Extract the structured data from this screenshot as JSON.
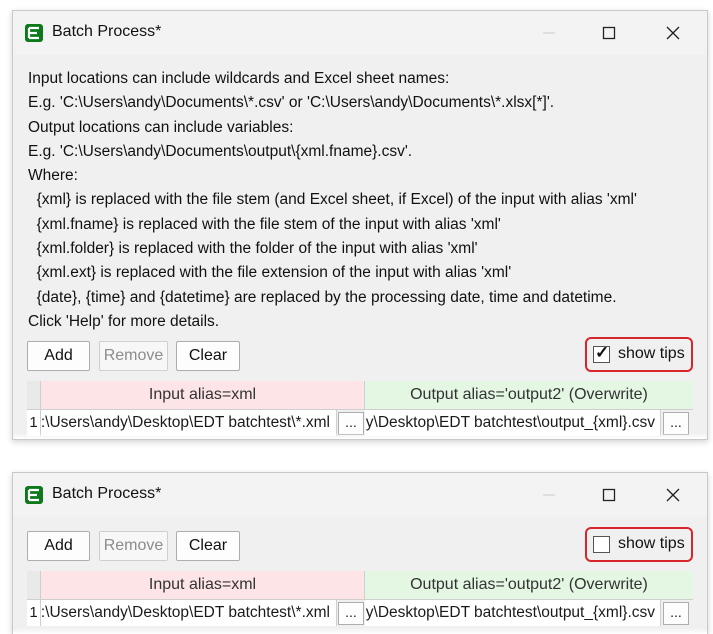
{
  "windows": [
    {
      "title": "Batch Process*",
      "help_lines": [
        "Input locations can include wildcards and Excel sheet names:",
        "E.g. 'C:\\Users\\andy\\Documents\\*.csv' or 'C:\\Users\\andy\\Documents\\*.xlsx[*]'.",
        "Output locations can include variables:",
        "E.g. 'C:\\Users\\andy\\Documents\\output\\{xml.fname}.csv'.",
        "Where:",
        "  {xml} is replaced with the file stem (and Excel sheet, if Excel) of the input with alias 'xml'",
        "  {xml.fname} is replaced with the file stem of the input with alias 'xml'",
        "  {xml.folder} is replaced with the folder of the input with alias 'xml'",
        "  {xml.ext} is replaced with the file extension of the input with alias 'xml'",
        "  {date}, {time} and {datetime} are replaced by the processing date, time and datetime.",
        "Click 'Help' for more details."
      ],
      "buttons": {
        "add": "Add",
        "remove": "Remove",
        "clear": "Clear"
      },
      "show_tips": {
        "label": "show tips",
        "checked": true,
        "check_glyph": "✓"
      },
      "grid": {
        "input_header": "Input alias=xml",
        "output_header": "Output alias='output2' (Overwrite)",
        "rows": [
          {
            "num": "1",
            "input": "C:\\Users\\andy\\Desktop\\EDT batchtest\\*.xml",
            "output": "C:\\Users\\andy\\Desktop\\EDT batchtest\\output_{xml}.csv",
            "browse": "..."
          }
        ]
      }
    },
    {
      "title": "Batch Process*",
      "buttons": {
        "add": "Add",
        "remove": "Remove",
        "clear": "Clear"
      },
      "show_tips": {
        "label": "show tips",
        "checked": false
      },
      "grid": {
        "input_header": "Input alias=xml",
        "output_header": "Output alias='output2' (Overwrite)",
        "rows": [
          {
            "num": "1",
            "input": "C:\\Users\\andy\\Desktop\\EDT batchtest\\*.xml",
            "output": "C:\\Users\\andy\\Desktop\\EDT batchtest\\output_{xml}.csv",
            "browse": "..."
          }
        ]
      }
    }
  ],
  "colors": {
    "input_header_bg": "#fde4e6",
    "output_header_bg": "#e3f7e3",
    "highlight_border": "#d7262b",
    "app_icon": "#0c7a1a"
  },
  "icons": {
    "app": "app-logo-icon",
    "minimize": "minimize-icon",
    "maximize": "maximize-icon",
    "close": "close-icon"
  }
}
